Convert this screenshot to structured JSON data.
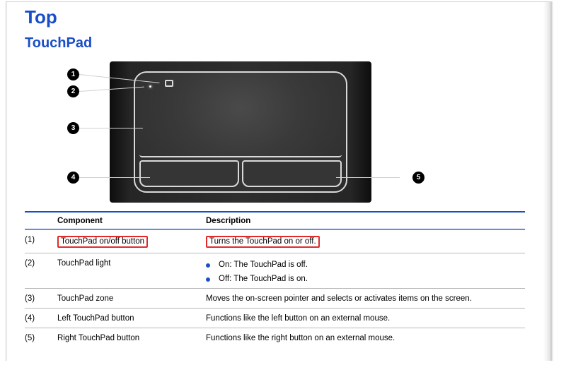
{
  "headings": {
    "top": "Top",
    "section": "TouchPad"
  },
  "figure": {
    "callouts": {
      "1": "1",
      "2": "2",
      "3": "3",
      "4": "4",
      "5": "5"
    }
  },
  "table": {
    "headers": {
      "component": "Component",
      "description": "Description"
    },
    "rows": [
      {
        "num": "(1)",
        "component": "TouchPad on/off button",
        "component_highlighted": true,
        "description": "Turns the TouchPad on or off.",
        "description_highlighted": true
      },
      {
        "num": "(2)",
        "component": "TouchPad light",
        "bullets": [
          "On: The TouchPad is off.",
          "Off: The TouchPad is on."
        ]
      },
      {
        "num": "(3)",
        "component": "TouchPad zone",
        "description": "Moves the on-screen pointer and selects or activates items on the screen."
      },
      {
        "num": "(4)",
        "component": "Left TouchPad button",
        "description": "Functions like the left button on an external mouse."
      },
      {
        "num": "(5)",
        "component": "Right TouchPad button",
        "description": "Functions like the right button on an external mouse."
      }
    ]
  }
}
